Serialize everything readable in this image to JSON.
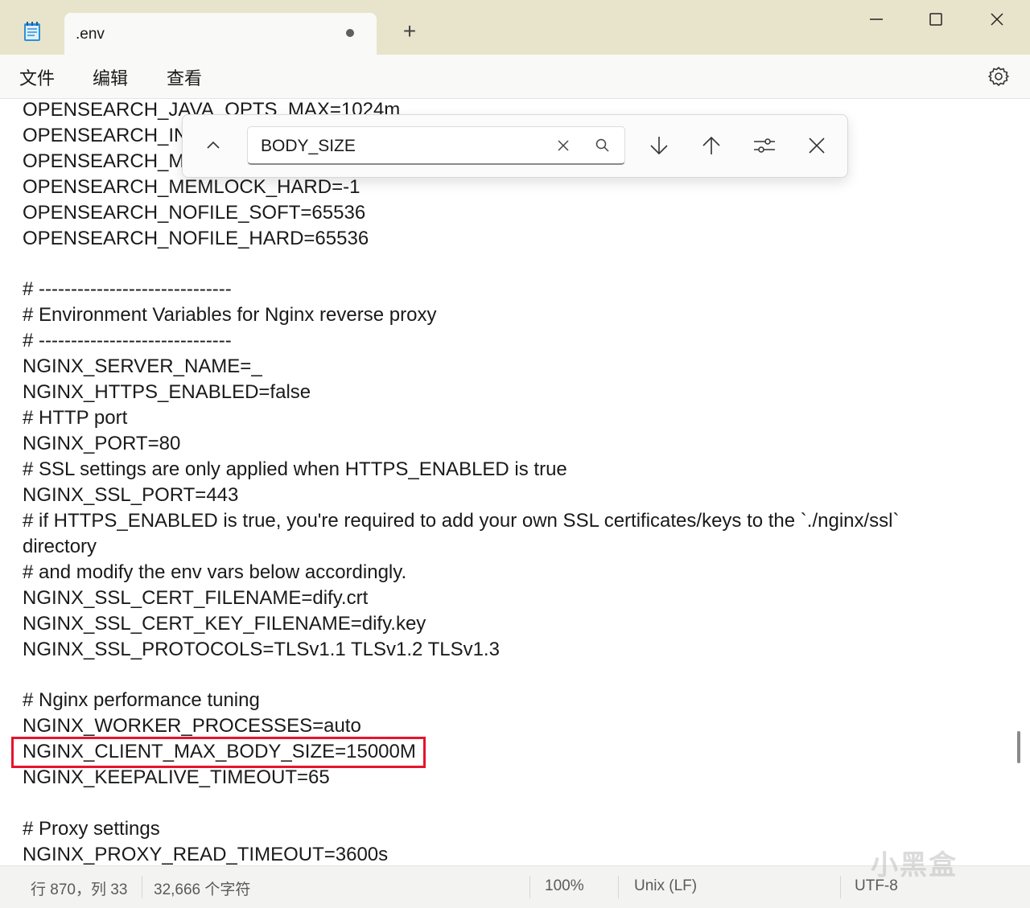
{
  "titlebar": {
    "tab_title": ".env",
    "new_tab": "+",
    "icons": [
      "notepad-icon",
      "unsaved-dot-icon",
      "minimize-icon",
      "maximize-icon",
      "close-icon"
    ]
  },
  "menu": {
    "file": "文件",
    "edit": "编辑",
    "view": "查看",
    "settings_icon": "gear-icon"
  },
  "find": {
    "value": "BODY_SIZE",
    "icons": [
      "chevron-up-icon",
      "clear-icon",
      "search-icon",
      "arrow-down-icon",
      "arrow-up-icon",
      "options-icon",
      "close-icon"
    ]
  },
  "editor": {
    "lines": [
      "OPENSEARCH_JAVA_OPTS_MAX=1024m",
      "OPENSEARCH_IN",
      "OPENSEARCH_MI",
      "OPENSEARCH_MEMLOCK_HARD=-1",
      "OPENSEARCH_NOFILE_SOFT=65536",
      "OPENSEARCH_NOFILE_HARD=65536",
      "",
      "# ------------------------------",
      "# Environment Variables for Nginx reverse proxy",
      "# ------------------------------",
      "NGINX_SERVER_NAME=_",
      "NGINX_HTTPS_ENABLED=false",
      "# HTTP port",
      "NGINX_PORT=80",
      "# SSL settings are only applied when HTTPS_ENABLED is true",
      "NGINX_SSL_PORT=443",
      "# if HTTPS_ENABLED is true, you're required to add your own SSL certificates/keys to the `./nginx/ssl`",
      "directory",
      "# and modify the env vars below accordingly.",
      "NGINX_SSL_CERT_FILENAME=dify.crt",
      "NGINX_SSL_CERT_KEY_FILENAME=dify.key",
      "NGINX_SSL_PROTOCOLS=TLSv1.1 TLSv1.2 TLSv1.3",
      "",
      "# Nginx performance tuning",
      "NGINX_WORKER_PROCESSES=auto",
      "NGINX_CLIENT_MAX_BODY_SIZE=15000M",
      "NGINX_KEEPALIVE_TIMEOUT=65",
      "",
      "# Proxy settings",
      "NGINX_PROXY_READ_TIMEOUT=3600s"
    ],
    "highlighted_line": "NGINX_CLIENT_MAX_BODY_SIZE=15000M",
    "highlight_color": "#e5142c"
  },
  "status": {
    "position": "行 870，列 33",
    "chars": "32,666 个字符",
    "zoom": "100%",
    "line_ending": "Unix (LF)",
    "encoding": "UTF-8"
  },
  "watermark": "小黑盒"
}
